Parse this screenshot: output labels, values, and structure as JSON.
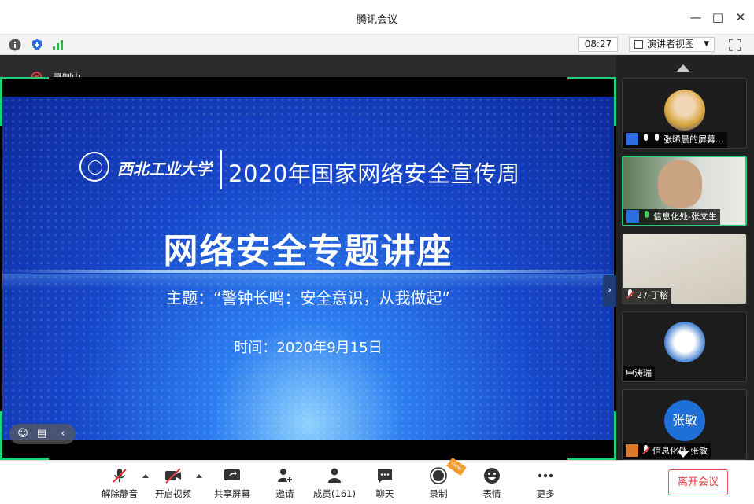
{
  "window": {
    "title": "腾讯会议"
  },
  "status": {
    "time": "08:27",
    "view_mode": "演讲者视图"
  },
  "recording": {
    "label": "录制中"
  },
  "slide": {
    "university": "西北工业大学",
    "title_line": "2020年国家网络安全宣传周",
    "main_title": "网络安全专题讲座",
    "theme": "主题：“警钟长鸣：安全意识，从我做起”",
    "time_line": "时间：2020年9月15日"
  },
  "participants": [
    {
      "name": "张晞晨的屏幕..."
    },
    {
      "name": "信息化处-张文生"
    },
    {
      "name": "27-丁榕"
    },
    {
      "name": "申涛瑞"
    },
    {
      "name": "信息化处-张敏",
      "avatar_text": "张敏"
    }
  ],
  "toolbar": {
    "unmute": "解除静音",
    "video": "开启视频",
    "share": "共享屏幕",
    "invite": "邀请",
    "members": "成员(161)",
    "chat": "聊天",
    "record": "录制",
    "emoji": "表情",
    "more": "更多",
    "new_tag": "new",
    "leave": "离开会议"
  },
  "colors": {
    "accent_green": "#1fd27a",
    "leave_red": "#e0393e",
    "brand_blue": "#2d6fde"
  }
}
